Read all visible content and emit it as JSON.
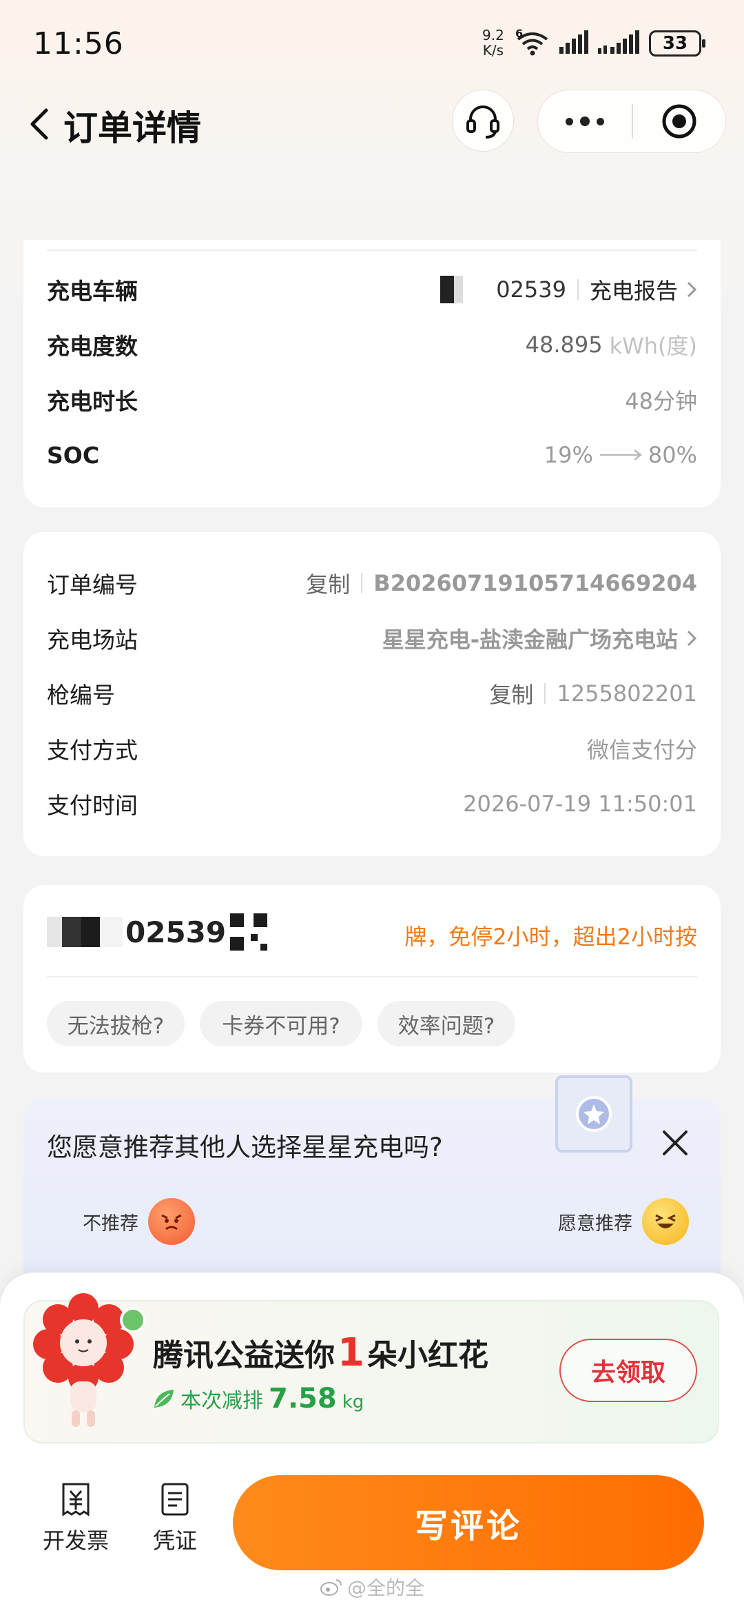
{
  "status_bar": {
    "time": "11:56",
    "net_speed_value": "9.2",
    "net_speed_unit": "K/s",
    "wifi_badge": "6",
    "battery": "33"
  },
  "nav": {
    "title": "订单详情"
  },
  "charge_info": {
    "rows": [
      {
        "label": "充电车辆",
        "plate_suffix": "02539",
        "action": "充电报告"
      },
      {
        "label": "充电度数",
        "value": "48.895",
        "unit": "kWh(度)"
      },
      {
        "label": "充电时长",
        "value": "48分钟"
      },
      {
        "label": "SOC",
        "soc_from": "19%",
        "soc_to": "80%"
      }
    ]
  },
  "order_info": {
    "rows": [
      {
        "label": "订单编号",
        "copy": "复制",
        "value": "B20260719105714669204"
      },
      {
        "label": "充电场站",
        "value": "星星充电-盐渎金融广场充电站"
      },
      {
        "label": "枪编号",
        "copy": "复制",
        "value": "1255802201"
      },
      {
        "label": "支付方式",
        "value": "微信支付分"
      },
      {
        "label": "支付时间",
        "value": "2026-07-19 11:50:01"
      }
    ]
  },
  "qa": {
    "plate_suffix": "02539",
    "notice": "牌，免停2小时，超出2小时按",
    "chips": [
      "无法拔枪?",
      "卡券不可用?",
      "效率问题?"
    ]
  },
  "survey": {
    "question": "您愿意推荐其他人选择星星充电吗?",
    "low_label": "不推荐",
    "high_label": "愿意推荐"
  },
  "promo": {
    "title_pre": "腾讯公益送你",
    "title_num": "1",
    "title_post": "朵小红花",
    "sub_label": "本次减排",
    "sub_value": "7.58",
    "sub_unit": "kg",
    "claim": "去领取"
  },
  "bottom": {
    "invoice": "开发票",
    "voucher": "凭证",
    "review": "写评论"
  },
  "watermark": "@全的全",
  "colors": {
    "accent_orange": "#ff7a0e",
    "notice_orange": "#f07a1a",
    "green": "#27a046",
    "red": "#e0323a"
  }
}
